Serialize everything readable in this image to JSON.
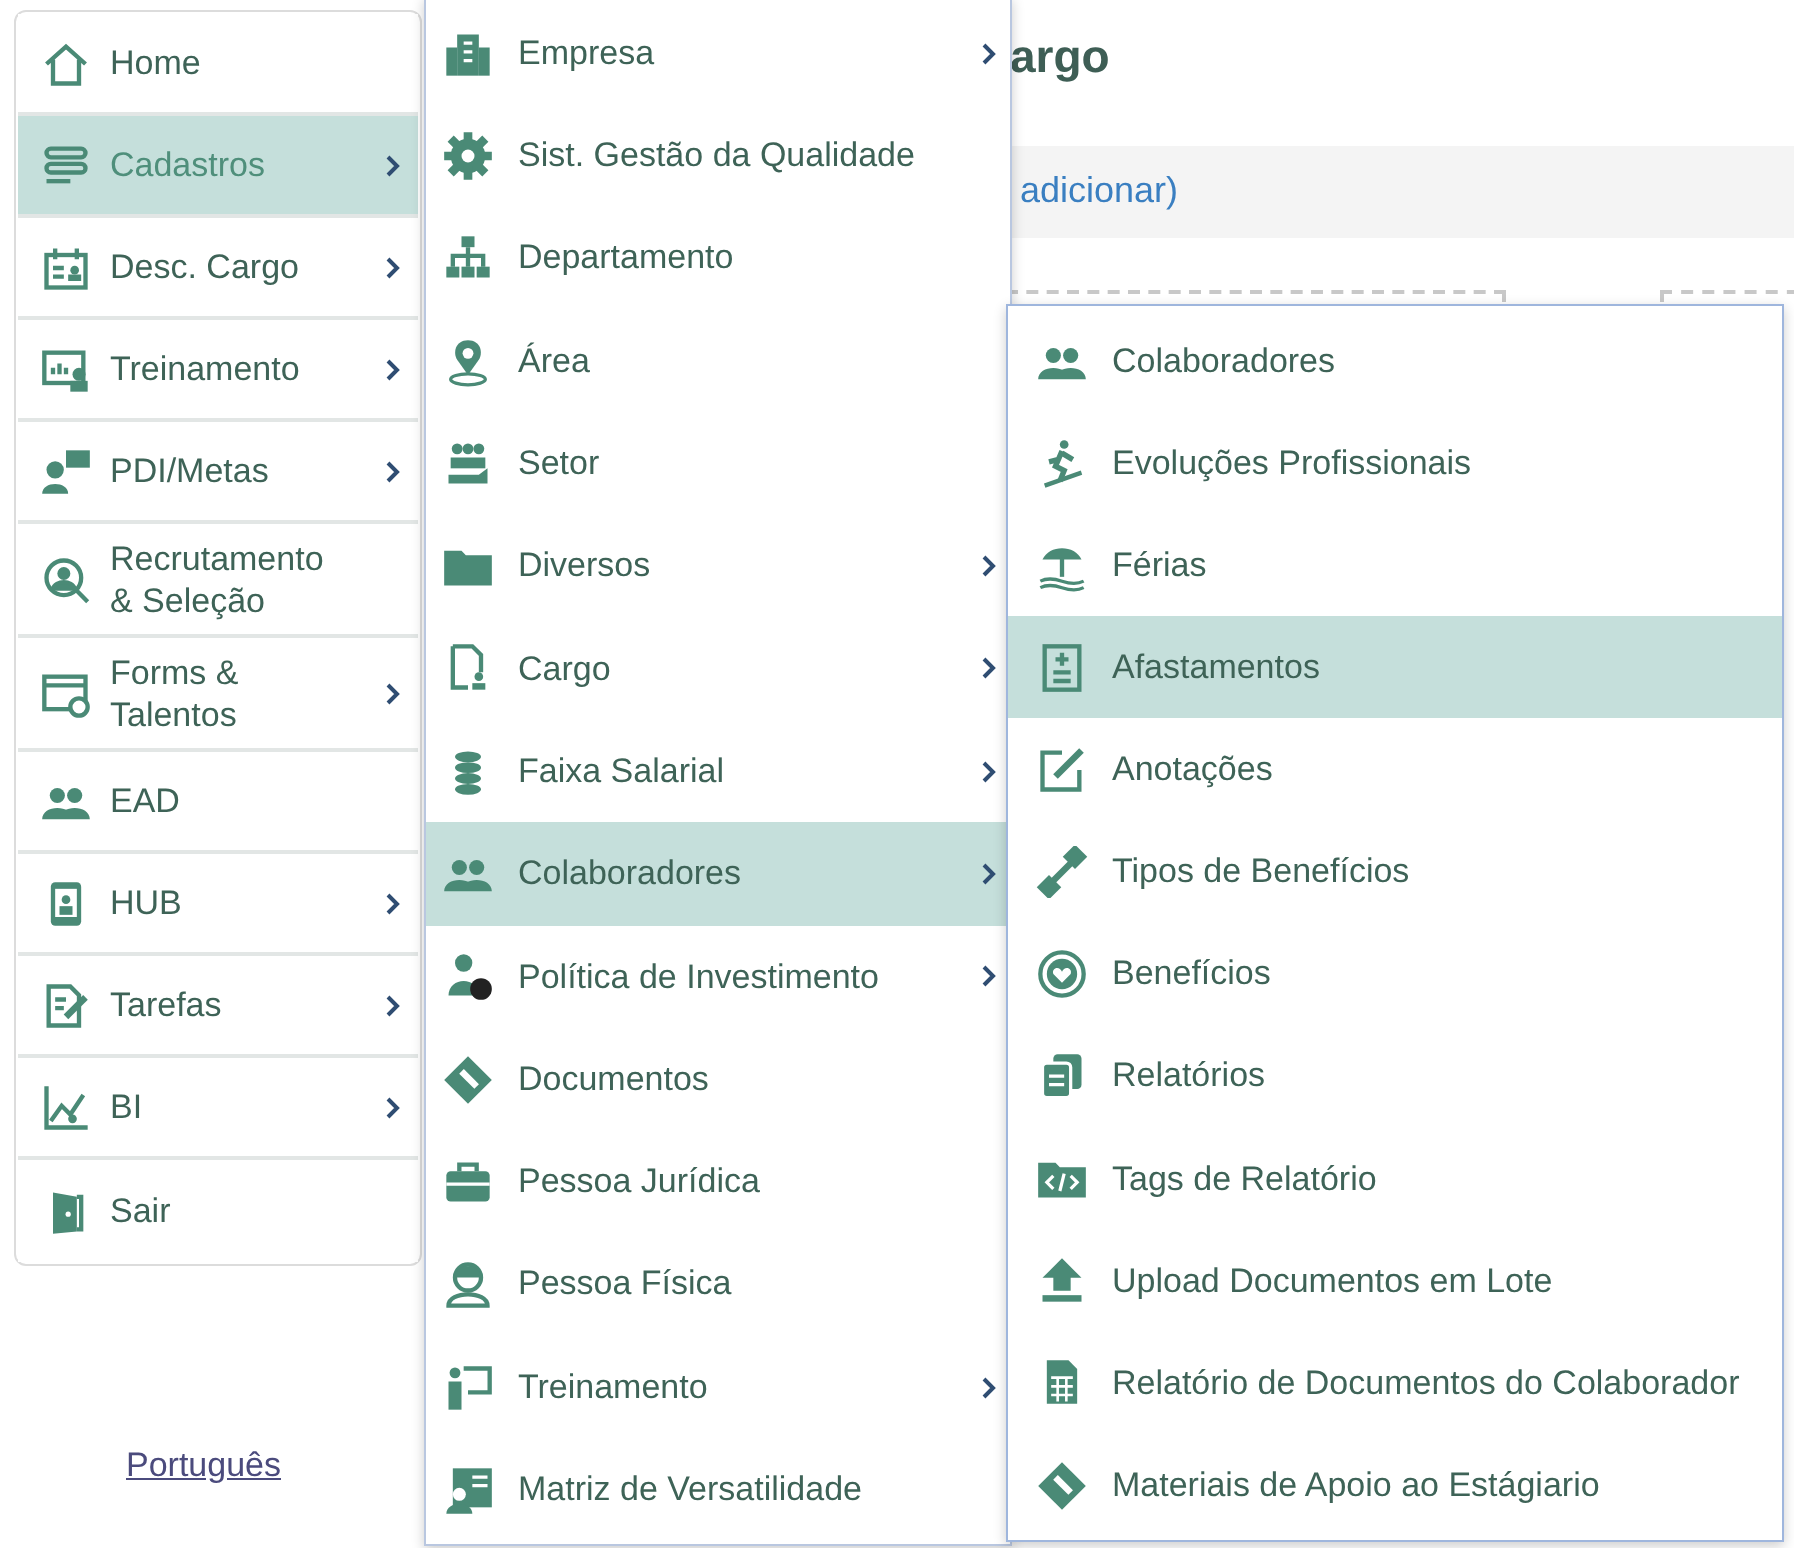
{
  "page": {
    "heading": "argo",
    "link": "adicionar)"
  },
  "sidebar": {
    "items": [
      {
        "label": "Home",
        "selected": false,
        "submenu": false
      },
      {
        "label": "Cadastros",
        "selected": true,
        "submenu": true
      },
      {
        "label": "Desc. Cargo",
        "selected": false,
        "submenu": true
      },
      {
        "label": "Treinamento",
        "selected": false,
        "submenu": true
      },
      {
        "label": "PDI/Metas",
        "selected": false,
        "submenu": true
      },
      {
        "label": "Recrutamento & Seleção",
        "selected": false,
        "submenu": false
      },
      {
        "label": "Forms & Talentos",
        "selected": false,
        "submenu": true
      },
      {
        "label": "EAD",
        "selected": false,
        "submenu": false
      },
      {
        "label": "HUB",
        "selected": false,
        "submenu": true
      },
      {
        "label": "Tarefas",
        "selected": false,
        "submenu": true
      },
      {
        "label": "BI",
        "selected": false,
        "submenu": true
      },
      {
        "label": "Sair",
        "selected": false,
        "submenu": false
      }
    ],
    "language": "Português"
  },
  "menu": {
    "items": [
      {
        "label": "Empresa",
        "selected": false,
        "submenu": true
      },
      {
        "label": "Sist. Gestão da Qualidade",
        "selected": false,
        "submenu": false
      },
      {
        "label": "Departamento",
        "selected": false,
        "submenu": false
      },
      {
        "label": "Área",
        "selected": false,
        "submenu": false
      },
      {
        "label": "Setor",
        "selected": false,
        "submenu": false
      },
      {
        "label": "Diversos",
        "selected": false,
        "submenu": true
      },
      {
        "label": "Cargo",
        "selected": false,
        "submenu": true
      },
      {
        "label": "Faixa Salarial",
        "selected": false,
        "submenu": true
      },
      {
        "label": "Colaboradores",
        "selected": true,
        "submenu": true
      },
      {
        "label": "Política de Investimento",
        "selected": false,
        "submenu": true
      },
      {
        "label": "Documentos",
        "selected": false,
        "submenu": false
      },
      {
        "label": "Pessoa Jurídica",
        "selected": false,
        "submenu": false
      },
      {
        "label": "Pessoa Física",
        "selected": false,
        "submenu": false
      },
      {
        "label": "Treinamento",
        "selected": false,
        "submenu": true
      },
      {
        "label": "Matriz de Versatilidade",
        "selected": false,
        "submenu": false
      }
    ]
  },
  "submenu": {
    "items": [
      {
        "label": "Colaboradores",
        "selected": false
      },
      {
        "label": "Evoluções Profissionais",
        "selected": false
      },
      {
        "label": "Férias",
        "selected": false
      },
      {
        "label": "Afastamentos",
        "selected": true
      },
      {
        "label": "Anotações",
        "selected": false
      },
      {
        "label": "Tipos de Benefícios",
        "selected": false
      },
      {
        "label": "Benefícios",
        "selected": false
      },
      {
        "label": "Relatórios",
        "selected": false
      },
      {
        "label": "Tags de Relatório",
        "selected": false
      },
      {
        "label": "Upload Documentos em Lote",
        "selected": false
      },
      {
        "label": "Relatório de Documentos do Colaborador",
        "selected": false
      },
      {
        "label": "Materiais de Apoio ao Estágiario",
        "selected": false
      }
    ]
  }
}
